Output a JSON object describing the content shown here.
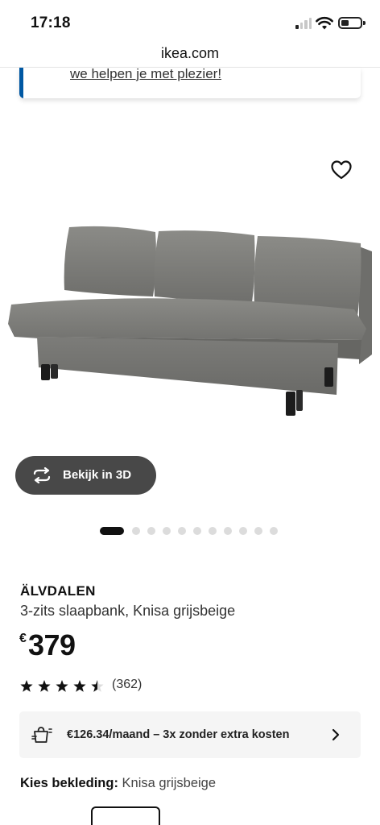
{
  "status_bar": {
    "time": "17:18",
    "icons": [
      "signal-icon",
      "wifi-icon",
      "battery-icon"
    ]
  },
  "browser": {
    "url": "ikea.com"
  },
  "banner": {
    "link_text": "we helpen je met plezier!",
    "accent_color": "#0058a3"
  },
  "product": {
    "favorite_icon": "heart-icon",
    "image_alt_icon": "sofa-bed-image",
    "view3d_label": "Bekijk in 3D",
    "view3d_icon": "rotate-icon",
    "carousel": {
      "total": 11,
      "active": 1
    },
    "name": "ÄLVDALEN",
    "description": "3-zits slaapbank, Knisa grijsbeige",
    "price_currency": "€",
    "price_value": "379",
    "rating": {
      "stars": 4.5,
      "max": 5,
      "count_text": "(362)"
    },
    "financing": {
      "icon": "shopping-bag-icon",
      "text": "€126.34/maand – 3x zonder extra kosten",
      "chevron_icon": "chevron-right-icon"
    },
    "upholstery": {
      "label": "Kies bekleding:",
      "value": "Knisa grijsbeige"
    }
  }
}
